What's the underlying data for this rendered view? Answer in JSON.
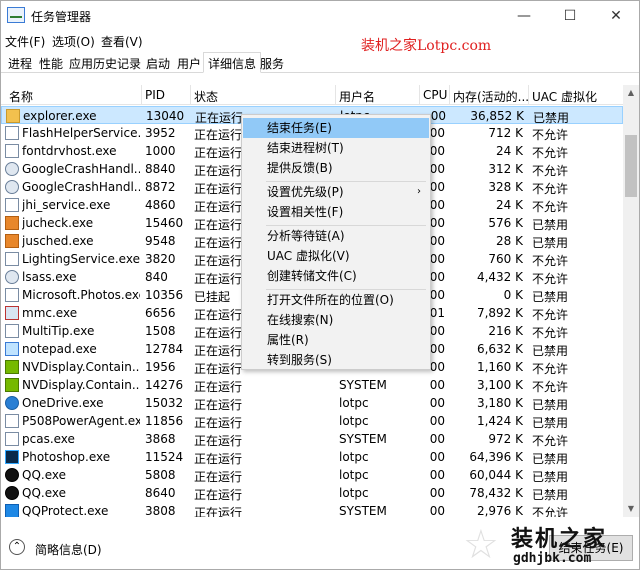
{
  "titlebar": {
    "title": "任务管理器",
    "minimize": "—",
    "maximize": "☐",
    "close": "✕"
  },
  "menu": [
    "文件(F)",
    "选项(O)",
    "查看(V)"
  ],
  "watermark_top": "装机之家Lotpc.com",
  "tabs": [
    "进程",
    "性能",
    "应用历史记录",
    "启动",
    "用户",
    "详细信息",
    "服务"
  ],
  "active_tab": "详细信息",
  "columns": [
    "名称",
    "PID",
    "状态",
    "用户名",
    "CPU",
    "内存(活动的...",
    "UAC 虚拟化"
  ],
  "rows": [
    {
      "name": "explorer.exe",
      "pid": "13040",
      "status": "正在运行",
      "user": "lotpc",
      "cpu": "00",
      "mem": "36,852 K",
      "uac": "已禁用",
      "icon": "folder-icon"
    },
    {
      "name": "FlashHelperService....",
      "pid": "3952",
      "status": "正在运行",
      "user": "",
      "cpu": "00",
      "mem": "712 K",
      "uac": "不允许",
      "icon": "app-icon"
    },
    {
      "name": "fontdrvhost.exe",
      "pid": "1000",
      "status": "正在运行",
      "user": "",
      "cpu": "00",
      "mem": "24 K",
      "uac": "不允许",
      "icon": "app-icon"
    },
    {
      "name": "GoogleCrashHandl...",
      "pid": "8840",
      "status": "正在运行",
      "user": "",
      "cpu": "00",
      "mem": "312 K",
      "uac": "不允许",
      "icon": "gear-icon"
    },
    {
      "name": "GoogleCrashHandl...",
      "pid": "8872",
      "status": "正在运行",
      "user": "",
      "cpu": "00",
      "mem": "328 K",
      "uac": "不允许",
      "icon": "gear-icon"
    },
    {
      "name": "jhi_service.exe",
      "pid": "4860",
      "status": "正在运行",
      "user": "",
      "cpu": "00",
      "mem": "24 K",
      "uac": "不允许",
      "icon": "app-icon"
    },
    {
      "name": "jucheck.exe",
      "pid": "15460",
      "status": "正在运行",
      "user": "",
      "cpu": "00",
      "mem": "576 K",
      "uac": "已禁用",
      "icon": "java-icon"
    },
    {
      "name": "jusched.exe",
      "pid": "9548",
      "status": "正在运行",
      "user": "",
      "cpu": "00",
      "mem": "28 K",
      "uac": "已禁用",
      "icon": "java-icon"
    },
    {
      "name": "LightingService.exe",
      "pid": "3820",
      "status": "正在运行",
      "user": "",
      "cpu": "00",
      "mem": "760 K",
      "uac": "不允许",
      "icon": "app-icon"
    },
    {
      "name": "lsass.exe",
      "pid": "840",
      "status": "正在运行",
      "user": "",
      "cpu": "00",
      "mem": "4,432 K",
      "uac": "不允许",
      "icon": "gear-icon"
    },
    {
      "name": "Microsoft.Photos.exe",
      "pid": "10356",
      "status": "已挂起",
      "user": "",
      "cpu": "00",
      "mem": "0 K",
      "uac": "已禁用",
      "icon": "photo-icon"
    },
    {
      "name": "mmc.exe",
      "pid": "6656",
      "status": "正在运行",
      "user": "",
      "cpu": "01",
      "mem": "7,892 K",
      "uac": "不允许",
      "icon": "mmc-icon"
    },
    {
      "name": "MultiTip.exe",
      "pid": "1508",
      "status": "正在运行",
      "user": "",
      "cpu": "00",
      "mem": "216 K",
      "uac": "不允许",
      "icon": "app-icon"
    },
    {
      "name": "notepad.exe",
      "pid": "12784",
      "status": "正在运行",
      "user": "",
      "cpu": "00",
      "mem": "6,632 K",
      "uac": "已禁用",
      "icon": "notepad-icon"
    },
    {
      "name": "NVDisplay.Contain...",
      "pid": "1956",
      "status": "正在运行",
      "user": "",
      "cpu": "00",
      "mem": "1,160 K",
      "uac": "不允许",
      "icon": "nvidia-icon"
    },
    {
      "name": "NVDisplay.Contain...",
      "pid": "14276",
      "status": "正在运行",
      "user": "SYSTEM",
      "cpu": "00",
      "mem": "3,100 K",
      "uac": "不允许",
      "icon": "nvidia-icon"
    },
    {
      "name": "OneDrive.exe",
      "pid": "15032",
      "status": "正在运行",
      "user": "lotpc",
      "cpu": "00",
      "mem": "3,180 K",
      "uac": "已禁用",
      "icon": "cloud-icon"
    },
    {
      "name": "P508PowerAgent.exe",
      "pid": "11856",
      "status": "正在运行",
      "user": "lotpc",
      "cpu": "00",
      "mem": "1,424 K",
      "uac": "已禁用",
      "icon": "app-icon"
    },
    {
      "name": "pcas.exe",
      "pid": "3868",
      "status": "正在运行",
      "user": "SYSTEM",
      "cpu": "00",
      "mem": "972 K",
      "uac": "不允许",
      "icon": "app-icon"
    },
    {
      "name": "Photoshop.exe",
      "pid": "11524",
      "status": "正在运行",
      "user": "lotpc",
      "cpu": "00",
      "mem": "64,396 K",
      "uac": "已禁用",
      "icon": "photoshop-icon"
    },
    {
      "name": "QQ.exe",
      "pid": "5808",
      "status": "正在运行",
      "user": "lotpc",
      "cpu": "00",
      "mem": "60,044 K",
      "uac": "已禁用",
      "icon": "qq-icon"
    },
    {
      "name": "QQ.exe",
      "pid": "8640",
      "status": "正在运行",
      "user": "lotpc",
      "cpu": "00",
      "mem": "78,432 K",
      "uac": "已禁用",
      "icon": "qq-icon"
    },
    {
      "name": "QQProtect.exe",
      "pid": "3808",
      "status": "正在运行",
      "user": "SYSTEM",
      "cpu": "00",
      "mem": "2,976 K",
      "uac": "不允许",
      "icon": "qq-shield-icon"
    }
  ],
  "context_menu": {
    "items": [
      "结束任务(E)",
      "结束进程树(T)",
      "提供反馈(B)",
      "设置优先级(P)",
      "设置相关性(F)",
      "分析等待链(A)",
      "UAC 虚拟化(V)",
      "创建转储文件(C)",
      "打开文件所在的位置(O)",
      "在线搜索(N)",
      "属性(R)",
      "转到服务(S)"
    ],
    "submenu_arrow": "›"
  },
  "footer": {
    "fewer_details": "简略信息(D)",
    "end_task": "结束任务(E)"
  },
  "watermark_bottom": {
    "line1": "装机之家",
    "line2": "gdhjbk.com"
  },
  "colors": {
    "selection": "#cce8ff",
    "menu_hover": "#91c9f7",
    "watermark_red": "#e02020"
  }
}
